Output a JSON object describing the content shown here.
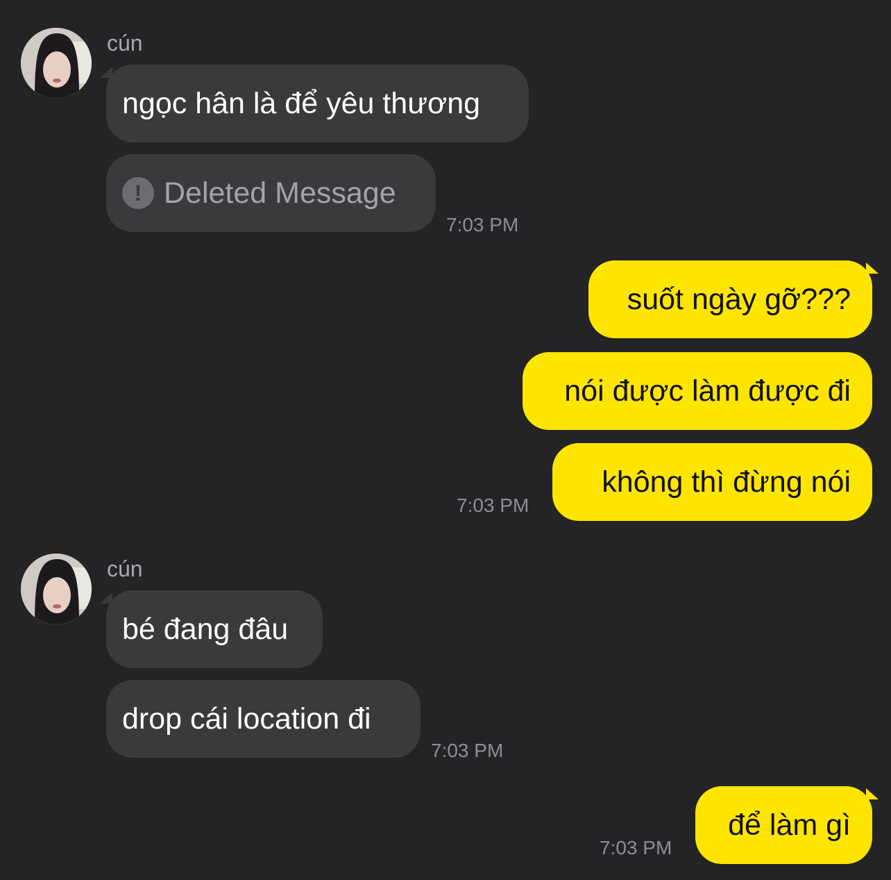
{
  "contact": {
    "name": "cún",
    "avatar_icon": "profile-photo"
  },
  "groups": [
    {
      "sender": "cún",
      "messages": [
        "ngọc hân là để yêu thương",
        "Deleted Message"
      ],
      "time": "7:03 PM"
    },
    {
      "sender": "me",
      "messages": [
        "suốt ngày gỡ???",
        "nói được làm được đi",
        "không thì đừng nói"
      ],
      "time": "7:03 PM"
    },
    {
      "sender": "cún",
      "messages": [
        "bé đang đâu",
        "drop cái location đi"
      ],
      "time": "7:03 PM"
    },
    {
      "sender": "me",
      "messages": [
        "để làm gì"
      ],
      "time": "7:03 PM"
    }
  ],
  "colors": {
    "background": "#242426",
    "incoming_bubble": "#3a3a3c",
    "outgoing_bubble": "#fee500",
    "timestamp": "#8e8e93"
  },
  "deleted_icon": "exclamation-icon"
}
